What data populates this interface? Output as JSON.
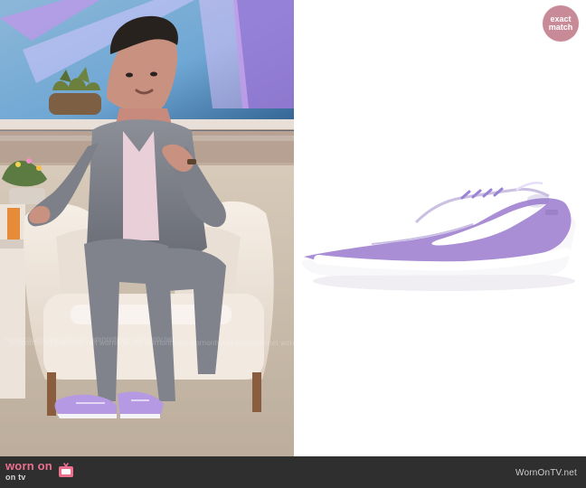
{
  "badge": {
    "top_label": "exact",
    "bottom_label": "match"
  },
  "footer": {
    "brand_top": "worn on",
    "brand_bottom": "on tv",
    "site_url": "WornOnTV.net"
  },
  "watermark": {
    "text": "wornontv.net  wornontv.net  wornontv.net  wornontv.net  wornontv.net  wornontv.net  wornontv.net  wornontv.net  wornontv.net  wornontv.net"
  },
  "colors": {
    "badge_bg": "#c98a98",
    "footer_bg": "#2f2f2f",
    "brand_pink": "#ec6f8d",
    "shoe_purple": "#a98ed6",
    "shoe_sole": "#f8f8fb",
    "shoe_swoosh": "#ffffff"
  },
  "icons": {
    "badge": "exact-match-badge",
    "tv": "tv-icon"
  }
}
